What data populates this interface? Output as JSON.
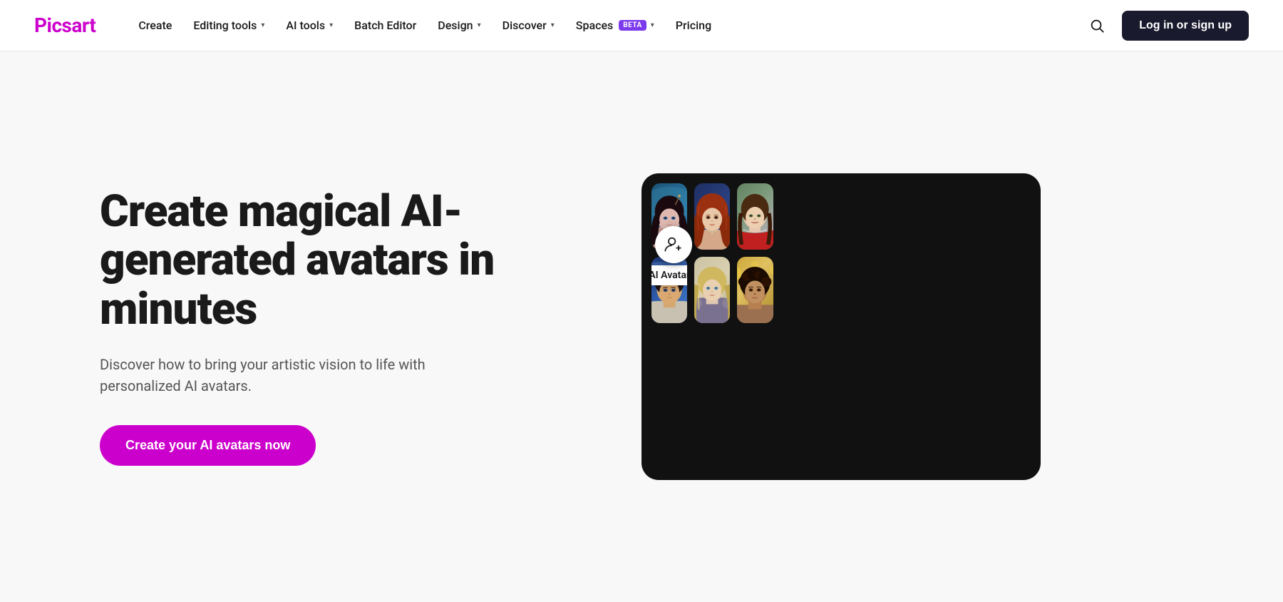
{
  "logo": {
    "text": "Picsart"
  },
  "nav": {
    "items": [
      {
        "id": "create",
        "label": "Create",
        "hasDropdown": false
      },
      {
        "id": "editing-tools",
        "label": "Editing tools",
        "hasDropdown": true
      },
      {
        "id": "ai-tools",
        "label": "AI tools",
        "hasDropdown": true
      },
      {
        "id": "batch-editor",
        "label": "Batch Editor",
        "hasDropdown": false
      },
      {
        "id": "design",
        "label": "Design",
        "hasDropdown": true
      },
      {
        "id": "discover",
        "label": "Discover",
        "hasDropdown": true
      },
      {
        "id": "spaces",
        "label": "Spaces",
        "badge": "BETA",
        "hasDropdown": true
      },
      {
        "id": "pricing",
        "label": "Pricing",
        "hasDropdown": false
      }
    ]
  },
  "header": {
    "login_label": "Log in or sign up"
  },
  "hero": {
    "title": "Create magical AI-generated avatars in minutes",
    "subtitle": "Discover how to bring your artistic vision to life with personalized AI avatars.",
    "cta_label": "Create your AI avatars now"
  },
  "collage": {
    "ai_avatar_label": "AI Avatar",
    "cells": [
      {
        "id": "cell-1",
        "description": "anime-girl-portrait"
      },
      {
        "id": "cell-2",
        "description": "redhead-woman-portrait"
      },
      {
        "id": "cell-3",
        "description": "smiling-woman-red-dress"
      },
      {
        "id": "cell-4",
        "description": "young-man-portrait"
      },
      {
        "id": "cell-5",
        "description": "blonde-warrior-woman"
      },
      {
        "id": "cell-6",
        "description": "brown-skin-woman-portrait"
      }
    ]
  },
  "colors": {
    "brand_purple": "#cc00cc",
    "nav_bg": "#ffffff",
    "login_bg": "#1a1a2e",
    "cta_bg": "#cc00cc",
    "spaces_badge_bg": "#7c3aed",
    "collage_bg": "#111111"
  }
}
